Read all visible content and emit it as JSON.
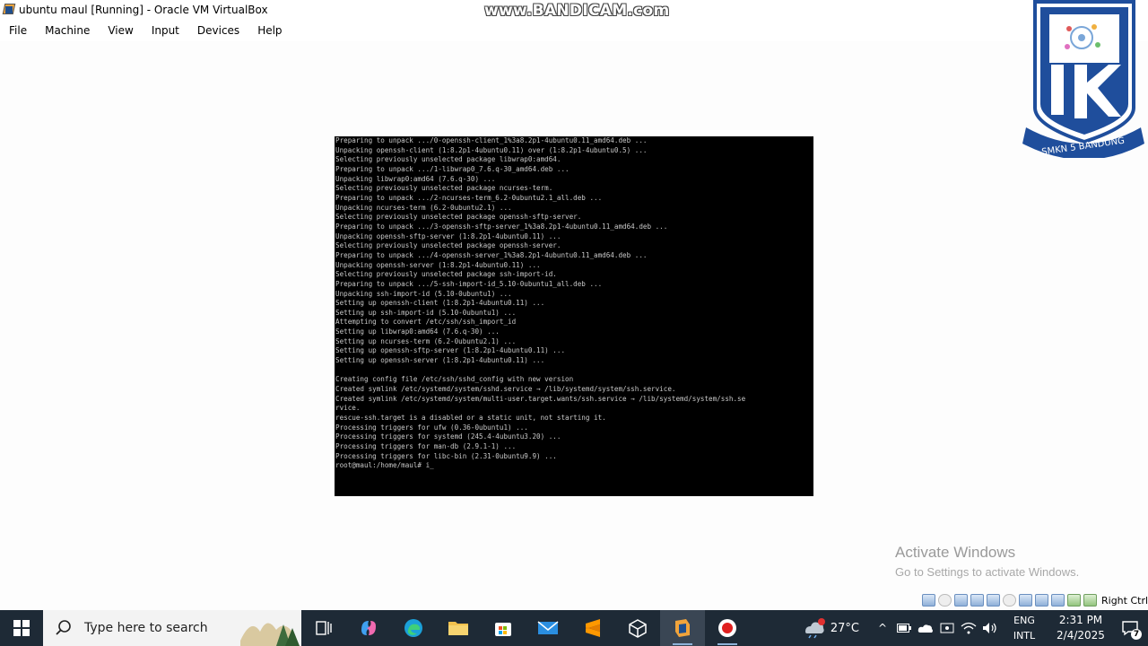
{
  "window": {
    "title": "ubuntu maul [Running] - Oracle VM VirtualBox",
    "watermark": "www.BANDICAM.com"
  },
  "menu": [
    "File",
    "Machine",
    "View",
    "Input",
    "Devices",
    "Help"
  ],
  "terminal_lines": [
    "Preparing to unpack .../0-openssh-client_1%3a8.2p1-4ubuntu0.11_amd64.deb ...",
    "Unpacking openssh-client (1:8.2p1-4ubuntu0.11) over (1:8.2p1-4ubuntu0.5) ...",
    "Selecting previously unselected package libwrap0:amd64.",
    "Preparing to unpack .../1-libwrap0_7.6.q-30_amd64.deb ...",
    "Unpacking libwrap0:amd64 (7.6.q-30) ...",
    "Selecting previously unselected package ncurses-term.",
    "Preparing to unpack .../2-ncurses-term_6.2-0ubuntu2.1_all.deb ...",
    "Unpacking ncurses-term (6.2-0ubuntu2.1) ...",
    "Selecting previously unselected package openssh-sftp-server.",
    "Preparing to unpack .../3-openssh-sftp-server_1%3a8.2p1-4ubuntu0.11_amd64.deb ...",
    "Unpacking openssh-sftp-server (1:8.2p1-4ubuntu0.11) ...",
    "Selecting previously unselected package openssh-server.",
    "Preparing to unpack .../4-openssh-server_1%3a8.2p1-4ubuntu0.11_amd64.deb ...",
    "Unpacking openssh-server (1:8.2p1-4ubuntu0.11) ...",
    "Selecting previously unselected package ssh-import-id.",
    "Preparing to unpack .../5-ssh-import-id_5.10-0ubuntu1_all.deb ...",
    "Unpacking ssh-import-id (5.10-0ubuntu1) ...",
    "Setting up openssh-client (1:8.2p1-4ubuntu0.11) ...",
    "Setting up ssh-import-id (5.10-0ubuntu1) ...",
    "Attempting to convert /etc/ssh/ssh_import_id",
    "Setting up libwrap0:amd64 (7.6.q-30) ...",
    "Setting up ncurses-term (6.2-0ubuntu2.1) ...",
    "Setting up openssh-sftp-server (1:8.2p1-4ubuntu0.11) ...",
    "Setting up openssh-server (1:8.2p1-4ubuntu0.11) ...",
    "",
    "Creating config file /etc/ssh/sshd_config with new version",
    "Created symlink /etc/systemd/system/sshd.service → /lib/systemd/system/ssh.service.",
    "Created symlink /etc/systemd/system/multi-user.target.wants/ssh.service → /lib/systemd/system/ssh.se",
    "rvice.",
    "rescue-ssh.target is a disabled or a static unit, not starting it.",
    "Processing triggers for ufw (0.36-0ubuntu1) ...",
    "Processing triggers for systemd (245.4-4ubuntu3.20) ...",
    "Processing triggers for man-db (2.9.1-1) ...",
    "Processing triggers for libc-bin (2.31-0ubuntu9.9) ...",
    "root@maul:/home/maul# i_"
  ],
  "logo": {
    "text": "SMKN 5 BANDUNG"
  },
  "activation": {
    "title": "Activate Windows",
    "subtitle": "Go to Settings to activate Windows."
  },
  "vbox_status": {
    "host_key": "Right Ctrl"
  },
  "taskbar": {
    "search_placeholder": "Type here to search",
    "apps": [
      "task-view",
      "copilot",
      "edge",
      "file-explorer",
      "store",
      "mail",
      "sublime-text",
      "virtualbox-3d",
      "virtualbox",
      "bandicam"
    ],
    "temperature": "27°C",
    "language": {
      "code": "ENG",
      "layout": "INTL"
    },
    "time": "2:31 PM",
    "date": "2/4/2025",
    "notification_count": "7"
  },
  "colors": {
    "taskbar": "#1e2a36",
    "terminal_bg": "#000000",
    "terminal_fg": "#c8c8c8",
    "logo_blue": "#1f4e9c"
  }
}
